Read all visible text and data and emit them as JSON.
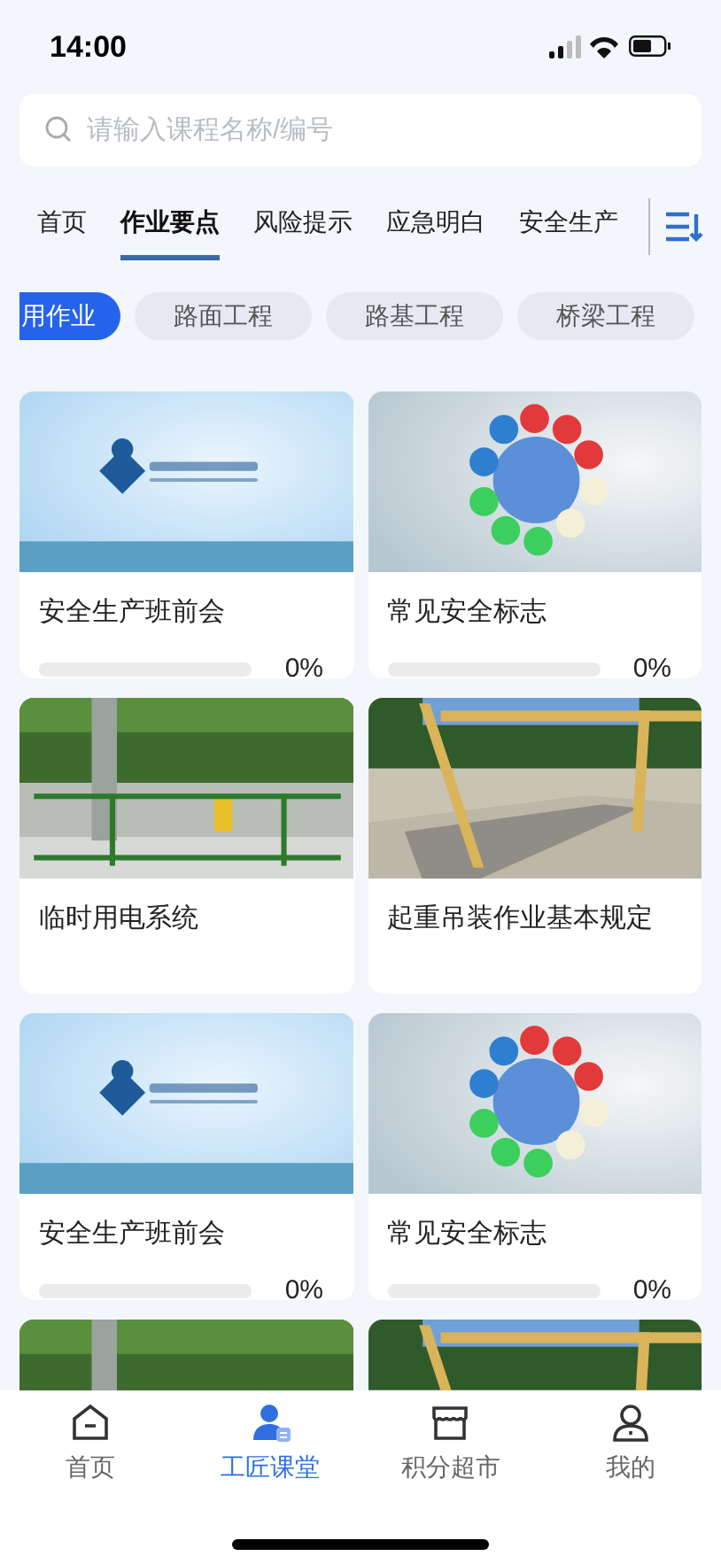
{
  "status_bar": {
    "time": "14:00"
  },
  "search": {
    "placeholder": "请输入课程名称/编号"
  },
  "tabs": [
    {
      "label": "首页",
      "selected": false
    },
    {
      "label": "作业要点",
      "selected": true
    },
    {
      "label": "风险提示",
      "selected": false
    },
    {
      "label": "应急明白",
      "selected": false
    },
    {
      "label": "安全生产",
      "selected": false
    }
  ],
  "chips": [
    {
      "label": "用作业",
      "selected": true
    },
    {
      "label": "路面工程",
      "selected": false
    },
    {
      "label": "路基工程",
      "selected": false
    },
    {
      "label": "桥梁工程",
      "selected": false
    }
  ],
  "courses": [
    {
      "kind": "progress",
      "title": "安全生产班前会",
      "level": 0,
      "percent": "0%"
    },
    {
      "kind": "progress",
      "title": "常见安全标志",
      "level": 0,
      "percent": "0%"
    },
    {
      "kind": "plain",
      "title": "临时用电系统"
    },
    {
      "kind": "plain",
      "title": "起重吊装作业基本规定"
    },
    {
      "kind": "progress",
      "title": "安全生产班前会",
      "level": 0,
      "percent": "0%"
    },
    {
      "kind": "progress",
      "title": "常见安全标志",
      "level": 0,
      "percent": "0%"
    },
    {
      "kind": "picture"
    },
    {
      "kind": "picture"
    }
  ],
  "bottom_nav": [
    {
      "label": "首页",
      "selected": false
    },
    {
      "label": "工匠课堂",
      "selected": true
    },
    {
      "label": "积分超市",
      "selected": false
    },
    {
      "label": "我的",
      "selected": false
    }
  ]
}
